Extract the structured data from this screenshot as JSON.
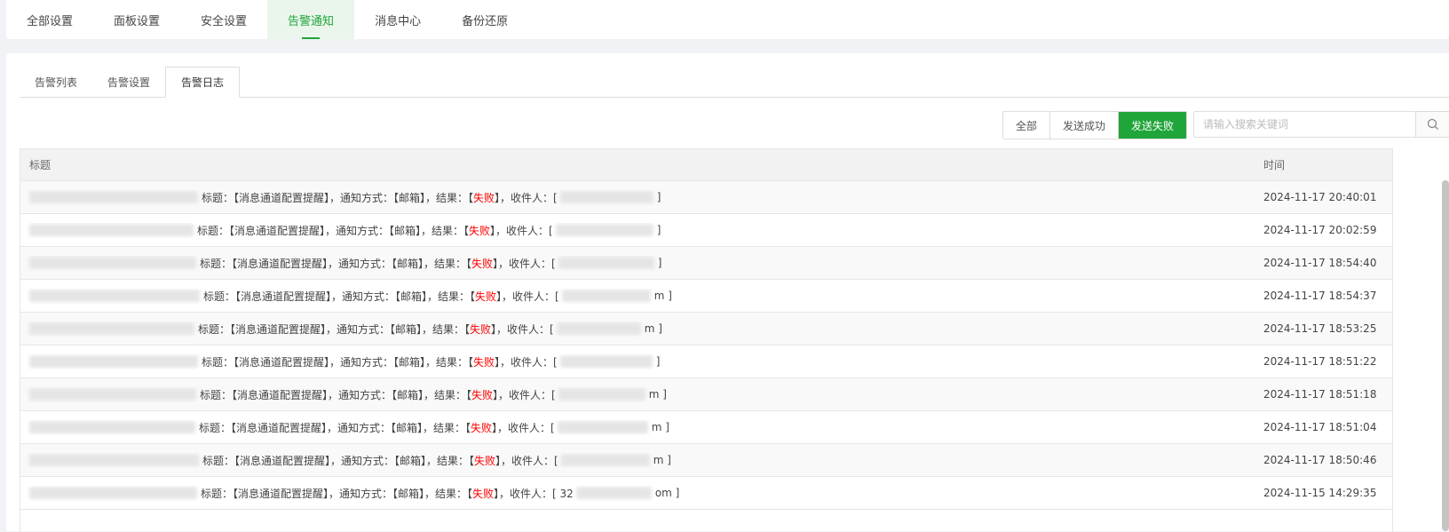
{
  "top_tabs": [
    "全部设置",
    "面板设置",
    "安全设置",
    "告警通知",
    "消息中心",
    "备份还原"
  ],
  "top_active": 3,
  "sub_tabs": [
    "告警列表",
    "告警设置",
    "告警日志"
  ],
  "sub_active": 2,
  "filters": [
    "全部",
    "发送成功",
    "发送失败"
  ],
  "filter_active": 2,
  "search": {
    "placeholder": "请输入搜索关键词",
    "value": ""
  },
  "table": {
    "headers": {
      "title": "标题",
      "time": "时间"
    },
    "rows": [
      {
        "prefix": "标题：【消息通道配置提醒】，通知方式：【邮箱】，结果：【",
        "status": "失败",
        "mid": "】，收件人：[",
        "suffix": "]",
        "time": "2024-11-17 20:40:01"
      },
      {
        "prefix": "标题：【消息通道配置提醒】，通知方式：【邮箱】，结果：【",
        "status": "失败",
        "mid": "】，收件人：[",
        "suffix": "]",
        "time": "2024-11-17 20:02:59"
      },
      {
        "prefix": "标题：【消息通道配置提醒】，通知方式：【邮箱】，结果：【",
        "status": "失败",
        "mid": "】，收件人：[",
        "suffix": "]",
        "time": "2024-11-17 18:54:40"
      },
      {
        "prefix": "标题：【消息通道配置提醒】，通知方式：【邮箱】，结果：【",
        "status": "失败",
        "mid": "】，收件人：[",
        "suffix": "m ]",
        "time": "2024-11-17 18:54:37"
      },
      {
        "prefix": "标题：【消息通道配置提醒】，通知方式：【邮箱】，结果：【",
        "status": "失败",
        "mid": "】，收件人：[",
        "suffix": "m ]",
        "time": "2024-11-17 18:53:25"
      },
      {
        "prefix": "标题：【消息通道配置提醒】，通知方式：【邮箱】，结果：【",
        "status": "失败",
        "mid": "】，收件人：[",
        "suffix": "]",
        "time": "2024-11-17 18:51:22"
      },
      {
        "prefix": "标题：【消息通道配置提醒】，通知方式：【邮箱】，结果：【",
        "status": "失败",
        "mid": "】，收件人：[",
        "suffix": "m ]",
        "time": "2024-11-17 18:51:18"
      },
      {
        "prefix": "标题：【消息通道配置提醒】，通知方式：【邮箱】，结果：【",
        "status": "失败",
        "mid": "】，收件人：[",
        "suffix": "m ]",
        "time": "2024-11-17 18:51:04"
      },
      {
        "prefix": "标题：【消息通道配置提醒】，通知方式：【邮箱】，结果：【",
        "status": "失败",
        "mid": "】，收件人：[",
        "suffix": "m ]",
        "time": "2024-11-17 18:50:46"
      },
      {
        "prefix": "标题：【消息通道配置提醒】，通知方式：【邮箱】，结果：【",
        "status": "失败",
        "mid": "】，收件人：[ 32",
        "suffix": "om ]",
        "time": "2024-11-15 14:29:35"
      }
    ]
  },
  "colors": {
    "accent": "#20a53a",
    "fail": "#ff0000"
  },
  "icons": {
    "search": "search-icon"
  }
}
